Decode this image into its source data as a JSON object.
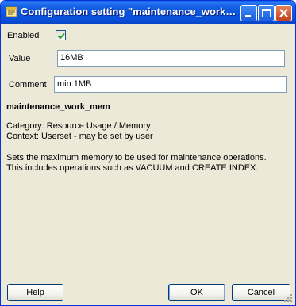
{
  "window": {
    "title": "Configuration setting \"maintenance_work_mem\""
  },
  "form": {
    "enabled_label": "Enabled",
    "enabled_checked": true,
    "value_label": "Value",
    "value": "16MB",
    "comment_label": "Comment",
    "comment": "min 1MB"
  },
  "info": {
    "name": "maintenance_work_mem",
    "category": "Category: Resource Usage / Memory",
    "context": "Context: Userset - may be set by user",
    "description_line1": "Sets the maximum memory to be used for maintenance operations.",
    "description_line2": "This includes operations such as VACUUM and CREATE INDEX."
  },
  "buttons": {
    "help": "Help",
    "ok": "OK",
    "cancel": "Cancel"
  },
  "icons": {
    "app": "config-window-icon",
    "minimize": "minimize-icon",
    "maximize": "maximize-icon",
    "close": "close-icon",
    "check": "checkmark-icon"
  },
  "colors": {
    "titlebar": "#0a54dc",
    "close_button": "#c4401d",
    "dialog_bg": "#ece9d8"
  }
}
